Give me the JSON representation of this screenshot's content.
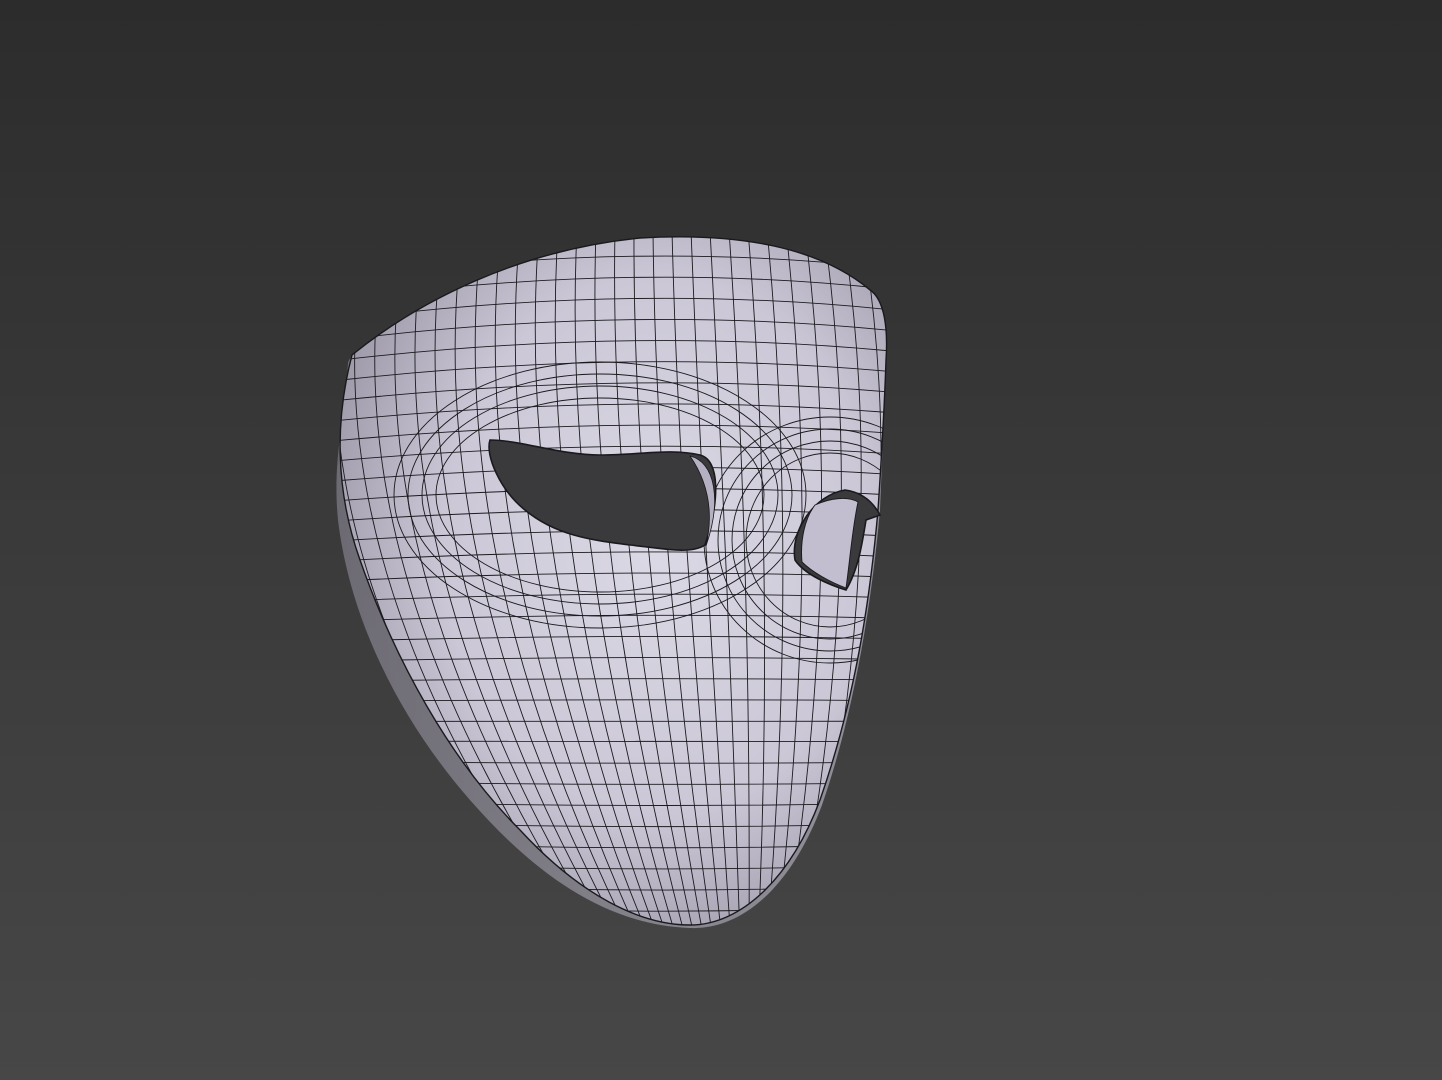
{
  "scene": {
    "object": "mask-wireframe",
    "colors": {
      "background_top": "#2c2c2c",
      "background_bottom": "#474747",
      "surface": "#d8d4e2",
      "surface_shadow": "#a8a3b4",
      "wire": "#1a1a1e",
      "hole": "#3a3a3c"
    }
  }
}
